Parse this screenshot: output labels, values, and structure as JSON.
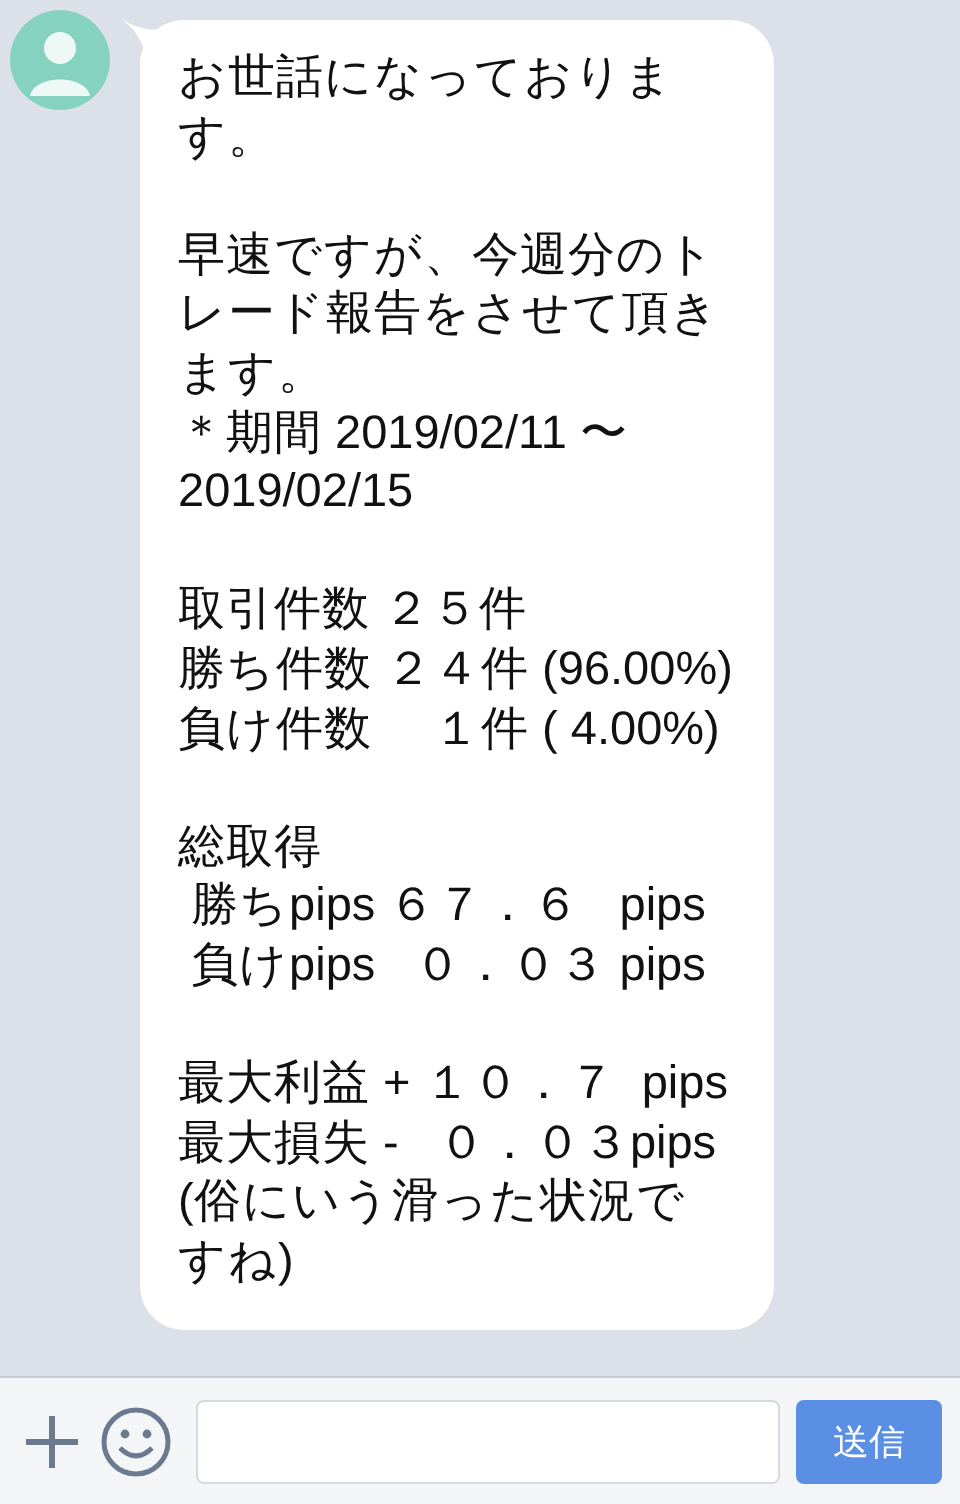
{
  "messages": [
    {
      "kind": "received",
      "paragraphs": [
        [
          "お世話になっております。"
        ],
        [
          "早速ですが、今週分のトレード報告をさせて頂きます。",
          "＊期間 2019/02/11 〜 2019/02/15"
        ],
        [
          "取引件数 ２５件",
          "勝ち件数 ２４件 (96.00%)",
          "負け件数　 １件 ( 4.00%)"
        ],
        [
          "総取得",
          " 勝ちpips ６７．６   pips",
          " 負けpips   ０．０３ pips"
        ],
        [
          "最大利益 + １０．７  pips",
          "最大損失 -   ０．０３pips",
          "(俗にいう滑った状況ですね)"
        ]
      ]
    }
  ],
  "composer": {
    "send_button": "送信"
  }
}
